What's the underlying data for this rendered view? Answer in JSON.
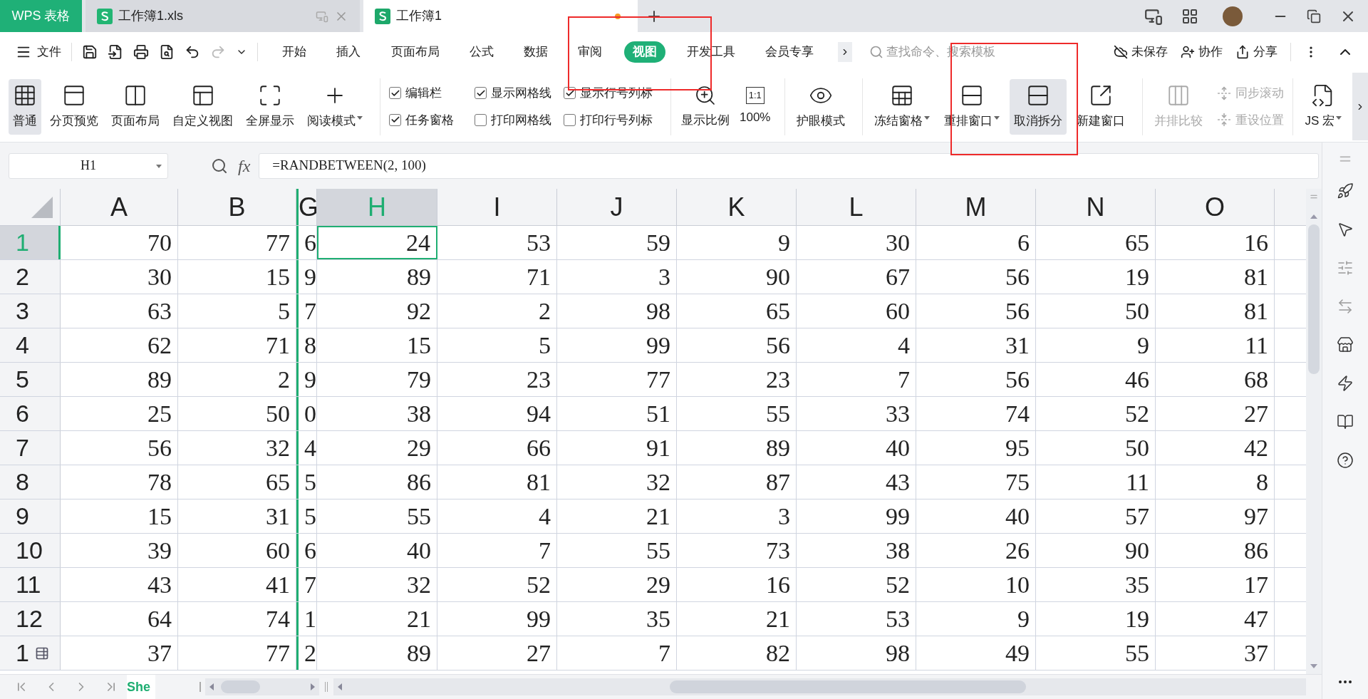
{
  "app_tab": "WPS 表格",
  "doc_tabs": [
    {
      "title": "工作簿1.xls",
      "selected": false,
      "unsaved": false
    },
    {
      "title": "工作簿1",
      "selected": true,
      "unsaved": true
    }
  ],
  "menu": {
    "file": "文件",
    "tabs": [
      {
        "label": "开始",
        "selected": false
      },
      {
        "label": "插入",
        "selected": false
      },
      {
        "label": "页面布局",
        "selected": false
      },
      {
        "label": "公式",
        "selected": false
      },
      {
        "label": "数据",
        "selected": false
      },
      {
        "label": "审阅",
        "selected": false
      },
      {
        "label": "视图",
        "selected": true
      },
      {
        "label": "开发工具",
        "selected": false
      },
      {
        "label": "会员专享",
        "selected": false
      }
    ],
    "search": {
      "placeholder": "查找命令、搜索模板"
    },
    "actions": [
      "未保存",
      "协作",
      "分享"
    ]
  },
  "ribbon": {
    "view_modes": [
      {
        "label": "普通",
        "selected": true,
        "dropdown": false
      },
      {
        "label": "分页预览",
        "selected": false,
        "dropdown": false
      },
      {
        "label": "页面布局",
        "selected": false,
        "dropdown": false
      },
      {
        "label": "自定义视图",
        "selected": false,
        "dropdown": false
      },
      {
        "label": "全屏显示",
        "selected": false,
        "dropdown": false
      },
      {
        "label": "阅读模式",
        "selected": false,
        "dropdown": true
      }
    ],
    "options": [
      {
        "label": "编辑栏",
        "checked": true
      },
      {
        "label": "显示网格线",
        "checked": true
      },
      {
        "label": "显示行号列标",
        "checked": true
      },
      {
        "label": "任务窗格",
        "checked": true
      },
      {
        "label": "打印网格线",
        "checked": false
      },
      {
        "label": "打印行号列标",
        "checked": false
      }
    ],
    "zoom": {
      "label": "显示比例"
    },
    "actual_size": {
      "icon_text": "1:1",
      "label": "100%"
    },
    "tools": [
      {
        "label": "护眼模式",
        "dropdown": false,
        "selected": false,
        "disabled": false
      },
      {
        "label": "冻结窗格",
        "dropdown": true,
        "selected": false,
        "disabled": false
      },
      {
        "label": "重排窗口",
        "dropdown": true,
        "selected": false,
        "disabled": false
      },
      {
        "label": "取消拆分",
        "dropdown": false,
        "selected": true,
        "disabled": false
      },
      {
        "label": "新建窗口",
        "dropdown": false,
        "selected": false,
        "disabled": false
      },
      {
        "label": "并排比较",
        "dropdown": false,
        "selected": false,
        "disabled": true
      }
    ],
    "sync": [
      {
        "label": "同步滚动",
        "disabled": true
      },
      {
        "label": "重设位置",
        "disabled": true
      }
    ],
    "macro": {
      "label": "JS 宏",
      "dropdown": true
    }
  },
  "formula_bar": {
    "name_box": "H1",
    "fx": "fx",
    "formula": "=RANDBETWEEN(2, 100)"
  },
  "columns": [
    {
      "label": "A",
      "selected": false
    },
    {
      "label": "B",
      "selected": false
    },
    {
      "label": "G",
      "selected": false
    },
    {
      "label": "H",
      "selected": true
    },
    {
      "label": "I",
      "selected": false
    },
    {
      "label": "J",
      "selected": false
    },
    {
      "label": "K",
      "selected": false
    },
    {
      "label": "L",
      "selected": false
    },
    {
      "label": "M",
      "selected": false
    },
    {
      "label": "N",
      "selected": false
    },
    {
      "label": "O",
      "selected": false
    }
  ],
  "rows": [
    {
      "label": "1",
      "selected": true,
      "cells": [
        "70",
        "77",
        "6",
        "24",
        "53",
        "59",
        "9",
        "30",
        "6",
        "65",
        "16"
      ]
    },
    {
      "label": "2",
      "selected": false,
      "cells": [
        "30",
        "15",
        "9",
        "89",
        "71",
        "3",
        "90",
        "67",
        "56",
        "19",
        "81"
      ]
    },
    {
      "label": "3",
      "selected": false,
      "cells": [
        "63",
        "5",
        "7",
        "92",
        "2",
        "98",
        "65",
        "60",
        "56",
        "50",
        "81"
      ]
    },
    {
      "label": "4",
      "selected": false,
      "cells": [
        "62",
        "71",
        "8",
        "15",
        "5",
        "99",
        "56",
        "4",
        "31",
        "9",
        "11"
      ]
    },
    {
      "label": "5",
      "selected": false,
      "cells": [
        "89",
        "2",
        "9",
        "79",
        "23",
        "77",
        "23",
        "7",
        "56",
        "46",
        "68"
      ]
    },
    {
      "label": "6",
      "selected": false,
      "cells": [
        "25",
        "50",
        "0",
        "38",
        "94",
        "51",
        "55",
        "33",
        "74",
        "52",
        "27"
      ]
    },
    {
      "label": "7",
      "selected": false,
      "cells": [
        "56",
        "32",
        "4",
        "29",
        "66",
        "91",
        "89",
        "40",
        "95",
        "50",
        "42"
      ]
    },
    {
      "label": "8",
      "selected": false,
      "cells": [
        "78",
        "65",
        "5",
        "86",
        "81",
        "32",
        "87",
        "43",
        "75",
        "11",
        "8"
      ]
    },
    {
      "label": "9",
      "selected": false,
      "cells": [
        "15",
        "31",
        "5",
        "55",
        "4",
        "21",
        "3",
        "99",
        "40",
        "57",
        "97"
      ]
    },
    {
      "label": "10",
      "selected": false,
      "cells": [
        "39",
        "60",
        "6",
        "40",
        "7",
        "55",
        "73",
        "38",
        "26",
        "90",
        "86"
      ]
    },
    {
      "label": "11",
      "selected": false,
      "cells": [
        "43",
        "41",
        "7",
        "32",
        "52",
        "29",
        "16",
        "52",
        "10",
        "35",
        "17"
      ]
    },
    {
      "label": "12",
      "selected": false,
      "cells": [
        "64",
        "74",
        "1",
        "21",
        "99",
        "35",
        "21",
        "53",
        "9",
        "19",
        "47"
      ]
    },
    {
      "label": "1",
      "selected": false,
      "cells": [
        "37",
        "77",
        "2",
        "89",
        "27",
        "7",
        "82",
        "98",
        "49",
        "55",
        "37"
      ]
    }
  ],
  "sheet_tabs": [
    {
      "label": "She",
      "selected": true
    }
  ]
}
